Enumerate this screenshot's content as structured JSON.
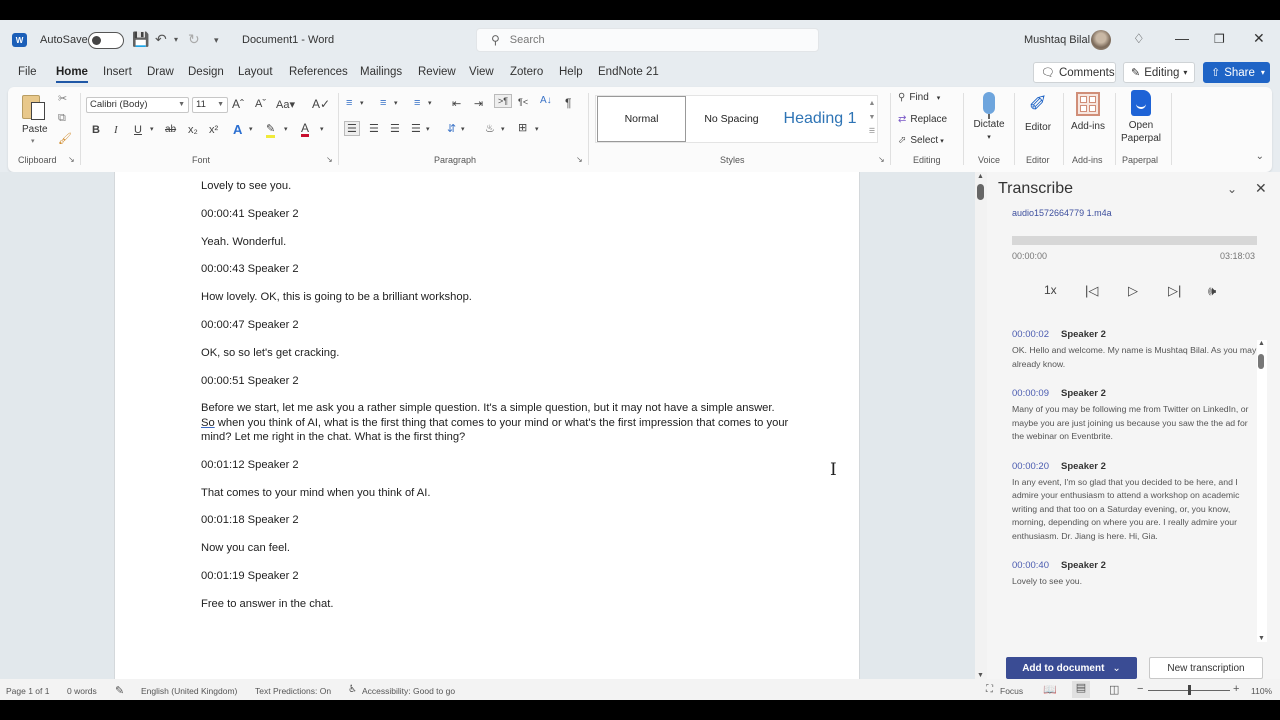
{
  "titlebar": {
    "autosave_label": "AutoSave",
    "doc_title": "Document1  -  Word",
    "search_placeholder": "Search",
    "user_name": "Mushtaq Bilal"
  },
  "menu": {
    "tabs": [
      "File",
      "Home",
      "Insert",
      "Draw",
      "Design",
      "Layout",
      "References",
      "Mailings",
      "Review",
      "View",
      "Zotero",
      "Help",
      "EndNote 21"
    ],
    "active_tab": "Home",
    "comments_label": "Comments",
    "editing_label": "Editing",
    "share_label": "Share"
  },
  "ribbon": {
    "paste_label": "Paste",
    "font_name": "Calibri (Body)",
    "font_size": "11",
    "groups": {
      "clipboard": "Clipboard",
      "font": "Font",
      "paragraph": "Paragraph",
      "styles": "Styles",
      "editing": "Editing",
      "voice": "Voice",
      "editor": "Editor",
      "addins": "Add-ins",
      "paperpal": "Paperpal"
    },
    "styles": [
      "Normal",
      "No Spacing",
      "Heading 1"
    ],
    "find_label": "Find",
    "replace_label": "Replace",
    "select_label": "Select",
    "dictate_label": "Dictate",
    "editor_label": "Editor",
    "addins_label": "Add-ins",
    "paperpal_label_1": "Open",
    "paperpal_label_2": "Paperpal"
  },
  "document": {
    "paragraphs": [
      "Lovely to see you.",
      "00:00:41 Speaker 2",
      "Yeah. Wonderful.",
      "00:00:43 Speaker 2",
      "How lovely. OK, this is going to be a brilliant workshop.",
      "00:00:47 Speaker 2",
      "OK, so so let's get cracking.",
      "00:00:51 Speaker 2",
      "00:01:12 Speaker 2",
      "That comes to your mind when you think of AI.",
      "00:01:18 Speaker 2",
      "Now you can feel.",
      "00:01:19 Speaker 2",
      "Free to answer in the chat."
    ],
    "long_paragraph": {
      "before": "Before we start, let me ask you a rather simple question. It's a simple question, but it may not have a simple answer. ",
      "underlined": "So",
      "after": " when you think of AI, what is the first thing that comes to your mind or what's the first impression that comes to your mind? Let me right in the chat. What is the first thing?"
    }
  },
  "transcribe": {
    "title": "Transcribe",
    "audio_file": "audio1572664779 1.m4a",
    "playback_progress": 0,
    "time_current": "00:00:00",
    "time_total": "03:18:03",
    "speed": "1x",
    "entries": [
      {
        "time": "00:00:02",
        "speaker": "Speaker 2",
        "text": "OK. Hello and welcome. My name is Mushtaq Bilal. As you may already know."
      },
      {
        "time": "00:00:09",
        "speaker": "Speaker 2",
        "text": "Many of you may be following me from Twitter on LinkedIn, or maybe you are just joining us because you saw the the ad for the webinar on Eventbrite."
      },
      {
        "time": "00:00:20",
        "speaker": "Speaker 2",
        "text": "In any event, I'm so glad that you decided to be here, and I admire your enthusiasm to attend a workshop on academic writing and that too on a Saturday evening, or, you know, morning, depending on where you are. I really admire your enthusiasm. Dr. Jiang is here. Hi, Gia."
      },
      {
        "time": "00:00:40",
        "speaker": "Speaker 2",
        "text": "Lovely to see you."
      }
    ],
    "add_to_document_label": "Add to document",
    "new_transcription_label": "New transcription"
  },
  "statusbar": {
    "page": "Page 1 of 1",
    "words": "0 words",
    "language": "English (United Kingdom)",
    "text_predictions": "Text Predictions: On",
    "accessibility": "Accessibility: Good to go",
    "focus": "Focus",
    "zoom": "110%"
  },
  "colors": {
    "accent": "#1f64c6",
    "add_button": "#3a4c94",
    "timestamp": "#4a5bb0"
  }
}
